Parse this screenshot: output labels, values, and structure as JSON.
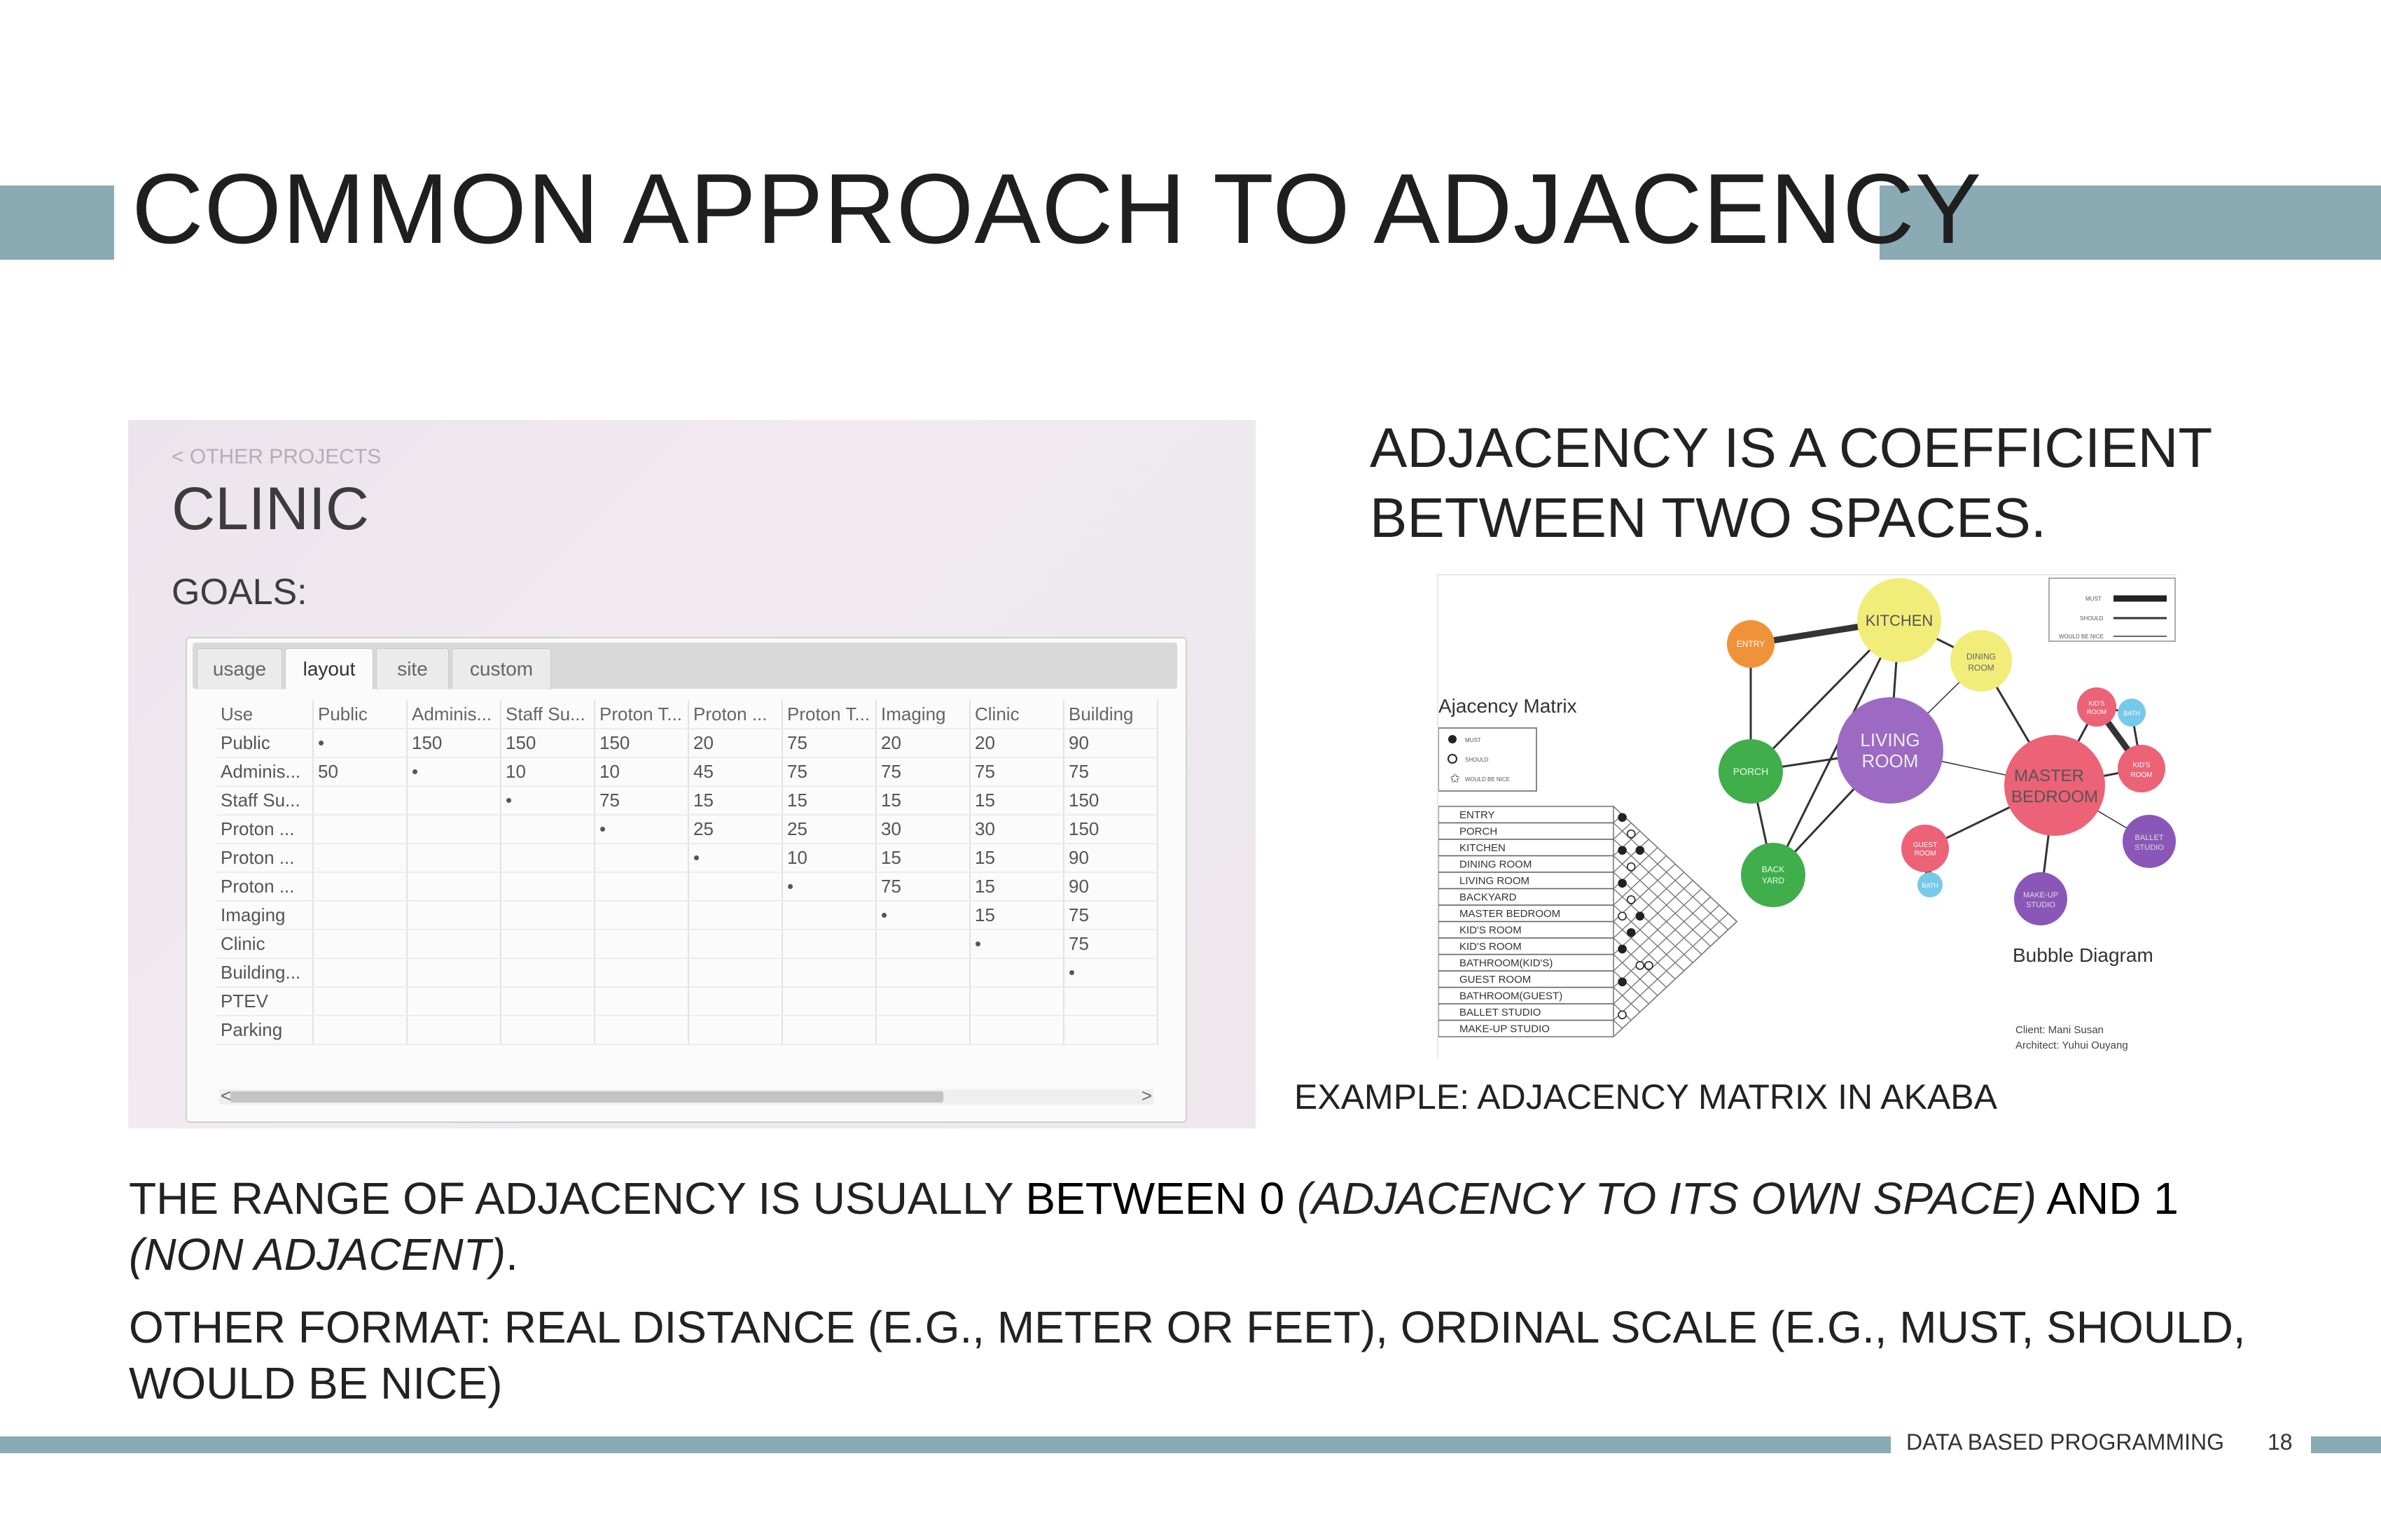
{
  "slide": {
    "title": "COMMON APPROACH TO ADJACENCY",
    "right_heading_line1": "ADJACENCY IS A COEFFICIENT",
    "right_heading_line2": "BETWEEN TWO SPACES.",
    "caption": "EXAMPLE: ADJACENCY MATRIX IN AKABA",
    "para1_a": "THE RANGE OF ADJACENCY IS USUALLY ",
    "para1_b": "BETWEEN 0 ",
    "para1_c": "(ADJACENCY TO ITS OWN SPACE)",
    "para1_d": " AND 1",
    "para1_e": "(NON ADJACENT)",
    "para1_f": ".",
    "para2": "OTHER FORMAT: REAL DISTANCE (E.G., METER OR FEET), ORDINAL SCALE (E.G., MUST, SHOULD, WOULD BE NICE)",
    "footer_label": "DATA BASED PROGRAMMING",
    "page_number": "18",
    "accent_color": "#8aaab4"
  },
  "clinic_app": {
    "back_link": "< OTHER PROJECTS",
    "title": "CLINIC",
    "goals_label": "GOALS:",
    "tabs": [
      "usage",
      "layout",
      "site",
      "custom"
    ],
    "active_tab": "layout",
    "columns": [
      "Use",
      "Public",
      "Adminis...",
      "Staff Su...",
      "Proton T...",
      "Proton ...",
      "Proton T...",
      "Imaging",
      "Clinic",
      "Building"
    ],
    "rows": [
      [
        "Public",
        "•",
        "150",
        "150",
        "150",
        "20",
        "75",
        "20",
        "20",
        "90"
      ],
      [
        "Adminis...",
        "50",
        "•",
        "10",
        "10",
        "45",
        "75",
        "75",
        "75",
        "75"
      ],
      [
        "Staff Su...",
        "",
        "",
        "•",
        "75",
        "15",
        "15",
        "15",
        "15",
        "150"
      ],
      [
        "Proton ...",
        "",
        "",
        "",
        "•",
        "25",
        "25",
        "30",
        "30",
        "150"
      ],
      [
        "Proton ...",
        "",
        "",
        "",
        "",
        "•",
        "10",
        "15",
        "15",
        "90"
      ],
      [
        "Proton ...",
        "",
        "",
        "",
        "",
        "",
        "•",
        "75",
        "15",
        "90"
      ],
      [
        "Imaging",
        "",
        "",
        "",
        "",
        "",
        "",
        "•",
        "15",
        "75"
      ],
      [
        "Clinic",
        "",
        "",
        "",
        "",
        "",
        "",
        "",
        "•",
        "75"
      ],
      [
        "Building...",
        "",
        "",
        "",
        "",
        "",
        "",
        "",
        "",
        "•"
      ],
      [
        "PTEV",
        "",
        "",
        "",
        "",
        "",
        "",
        "",
        "",
        ""
      ],
      [
        "Parking",
        "",
        "",
        "",
        "",
        "",
        "",
        "",
        "",
        ""
      ]
    ],
    "scroll_left": "<",
    "scroll_right": ">"
  },
  "bubble_figure": {
    "matrix_title": "Ajacency Matrix",
    "legend_matrix": [
      "MUST",
      "SHOULD",
      "WOULD BE NICE"
    ],
    "legend_lines": [
      "MUST",
      "SHOULD",
      "WOULD BE NICE"
    ],
    "rooms": [
      "ENTRY",
      "PORCH",
      "KITCHEN",
      "DINING ROOM",
      "LIVING ROOM",
      "BACKYARD",
      "MASTER BEDROOM",
      "KID'S ROOM",
      "KID'S ROOM",
      "BATHROOM(KID'S)",
      "GUEST ROOM",
      "BATHROOM(GUEST)",
      "BALLET STUDIO",
      "MAKE-UP STUDIO"
    ],
    "bubbles": {
      "kitchen": "KITCHEN",
      "entry": "ENTRY",
      "dining_1": "DINING",
      "dining_2": "ROOM",
      "living_1": "LIVING",
      "living_2": "ROOM",
      "porch": "PORCH",
      "master_1": "MASTER",
      "master_2": "BEDROOM",
      "kids1_1": "KID'S",
      "kids1_2": "ROOM",
      "kids2_1": "KID'S",
      "kids2_2": "ROOM",
      "bath": "BATH",
      "bath2": "BATH",
      "guest_1": "GUEST",
      "guest_2": "ROOM",
      "backyard_1": "BACK",
      "backyard_2": "YARD",
      "ballet_1": "BALLET",
      "ballet_2": "STUDIO",
      "makeup_1": "MAKE-UP",
      "makeup_2": "STUDIO"
    },
    "bubble_title": "Bubble Diagram",
    "client": "Client: Mani Susan",
    "architect": "Architect: Yuhui Ouyang"
  }
}
